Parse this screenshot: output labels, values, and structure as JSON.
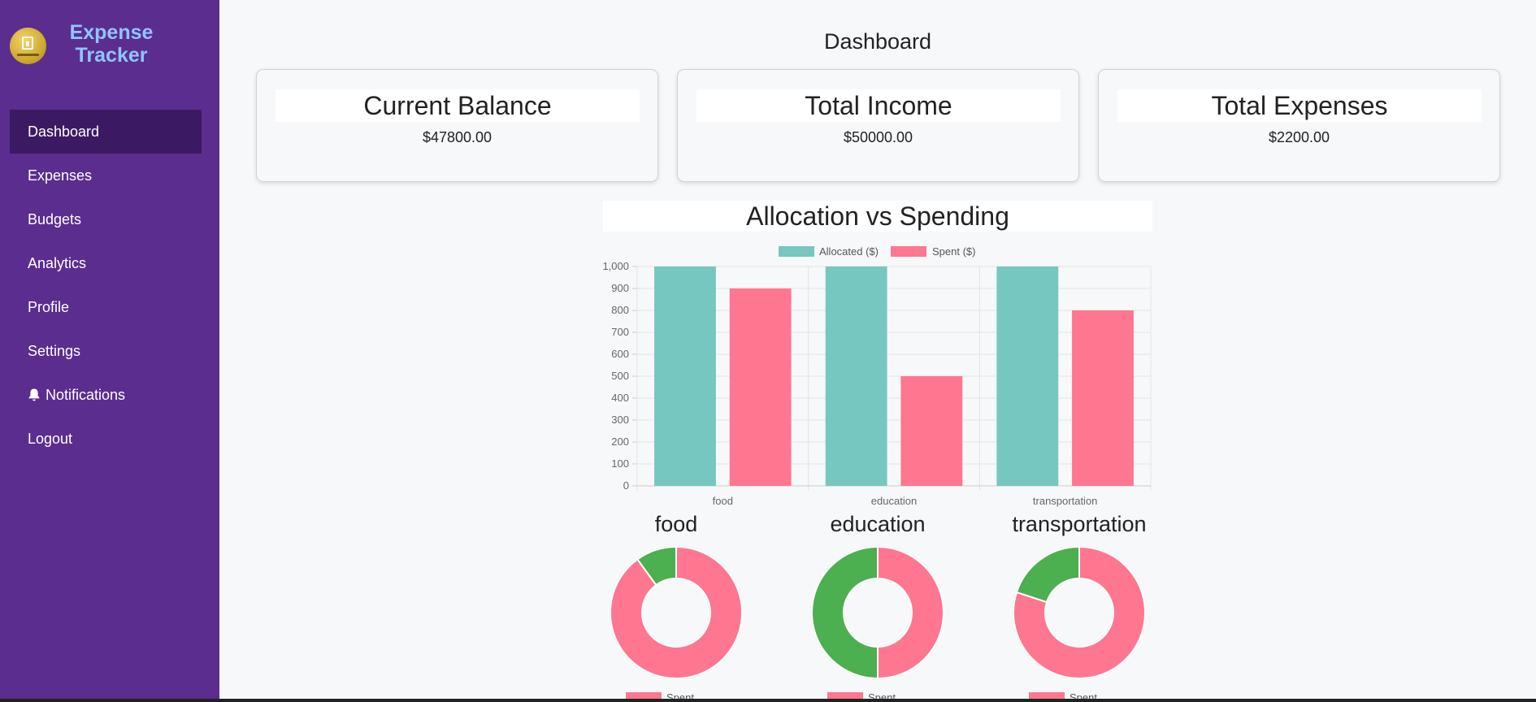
{
  "brand": {
    "title_line1": "Expense",
    "title_line2": "Tracker"
  },
  "nav": [
    {
      "label": "Dashboard",
      "active": true
    },
    {
      "label": "Expenses"
    },
    {
      "label": "Budgets"
    },
    {
      "label": "Analytics"
    },
    {
      "label": "Profile"
    },
    {
      "label": "Settings"
    },
    {
      "label": "Notifications",
      "icon": "bell-icon"
    },
    {
      "label": "Logout"
    }
  ],
  "page": {
    "title": "Dashboard"
  },
  "cards": [
    {
      "title": "Current Balance",
      "value": "$47800.00"
    },
    {
      "title": "Total Income",
      "value": "$50000.00"
    },
    {
      "title": "Total Expenses",
      "value": "$2200.00"
    }
  ],
  "colors": {
    "allocated": "#76c7c0",
    "spent": "#ff7690",
    "remaining": "#4caf50",
    "sidebar": "#5b2d8e",
    "active": "#3c1a63"
  },
  "chart_data": [
    {
      "type": "bar",
      "title": "Allocation vs Spending",
      "categories": [
        "food",
        "education",
        "transportation"
      ],
      "series": [
        {
          "name": "Allocated ($)",
          "values": [
            1000,
            1000,
            1000
          ]
        },
        {
          "name": "Spent ($)",
          "values": [
            900,
            500,
            800
          ]
        }
      ],
      "ylim": [
        0,
        1000
      ],
      "yticks": [
        "0",
        "100",
        "200",
        "300",
        "400",
        "500",
        "600",
        "700",
        "800",
        "900",
        "1,000"
      ],
      "legend": "top",
      "grid": true
    },
    {
      "type": "pie",
      "title": "food",
      "labels": [
        "Spent",
        ""
      ],
      "values": [
        900,
        100
      ],
      "legend": "bottom"
    },
    {
      "type": "pie",
      "title": "education",
      "labels": [
        "Spent",
        ""
      ],
      "values": [
        500,
        500
      ],
      "legend": "bottom"
    },
    {
      "type": "pie",
      "title": "transportation",
      "labels": [
        "Spent",
        ""
      ],
      "values": [
        800,
        200
      ],
      "legend": "bottom"
    }
  ]
}
